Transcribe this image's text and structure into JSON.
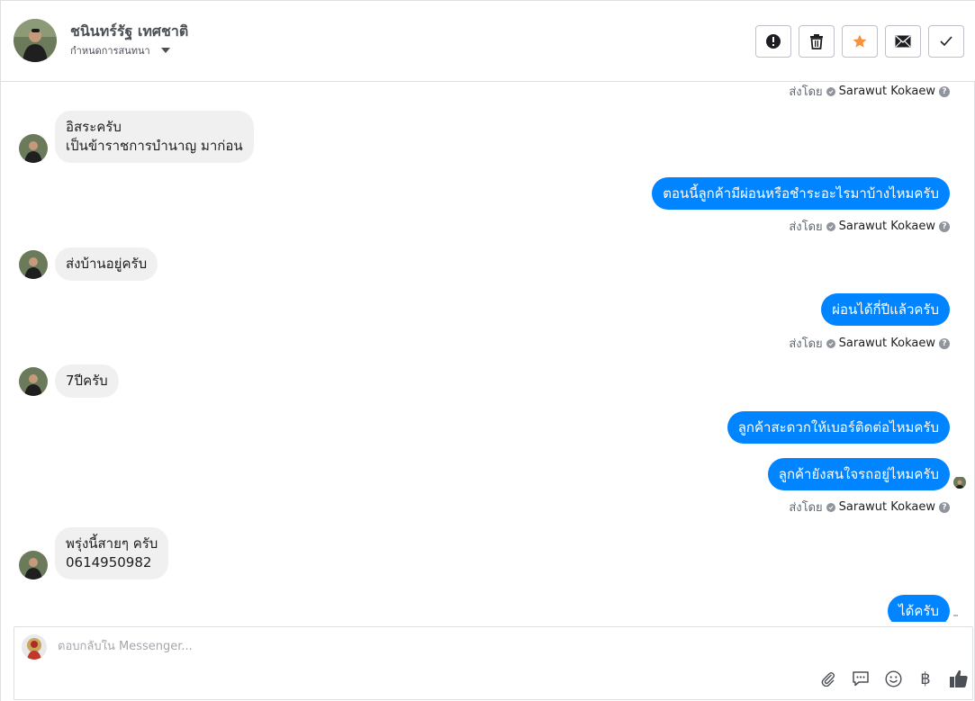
{
  "header": {
    "name": "ชนินทร์รัฐ เทศชาติ",
    "subtitle": "กำหนดการสนทนา",
    "actions": [
      {
        "icon": "exclamation-icon"
      },
      {
        "icon": "trash-icon"
      },
      {
        "icon": "star-icon"
      },
      {
        "icon": "envelope-icon"
      },
      {
        "icon": "check-icon"
      }
    ]
  },
  "thread": {
    "sent_by_label": "ส่งโดย",
    "sender": "Sarawut Kokaew",
    "help": "?",
    "messages": [
      {
        "dir": "in",
        "text": "อิสระครับ\nเป็นข้าราชการบำนาญ มาก่อน"
      },
      {
        "dir": "out",
        "text": "ตอนนี้ลูกค้ามีผ่อนหรือชำระอะไรมาบ้างไหมครับ"
      },
      {
        "dir": "in",
        "text": "ส่งบ้านอยู่ครับ"
      },
      {
        "dir": "out",
        "text": "ผ่อนได้กี่ปีแล้วครับ"
      },
      {
        "dir": "in",
        "text": "7ปีครับ"
      },
      {
        "dir": "out",
        "text": "ลูกค้าสะดวกให้เบอร์ติดต่อไหมครับ"
      },
      {
        "dir": "out",
        "text": "ลูกค้ายังสนใจรถอยู่ไหมครับ"
      },
      {
        "dir": "in",
        "text": "พรุ่งนี้สายๆ ครับ\n0614950982"
      },
      {
        "dir": "out",
        "text": "ได้ครับ"
      }
    ]
  },
  "composer": {
    "placeholder": "ตอบกลับใน Messenger...",
    "tools": [
      "paperclip-icon",
      "speech-bubble-icon",
      "smiley-icon",
      "baht-icon",
      "thumbs-up-icon"
    ],
    "baht_symbol": "฿"
  },
  "colors": {
    "accent": "#0084ff",
    "incoming_bubble": "#f1f0f0",
    "star": "#f7923b"
  }
}
